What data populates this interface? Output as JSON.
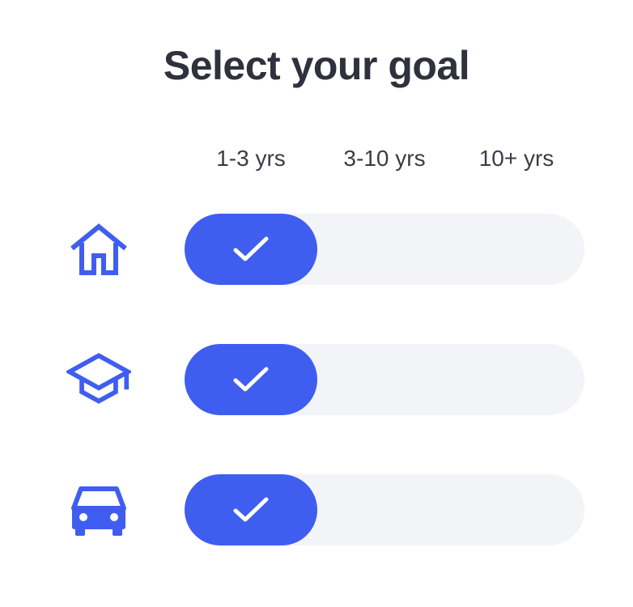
{
  "title": "Select your goal",
  "columns": [
    "1-3 yrs",
    "3-10 yrs",
    "10+ yrs"
  ],
  "rows": [
    {
      "icon": "house-icon",
      "selected": "1-3 yrs"
    },
    {
      "icon": "graduation-cap-icon",
      "selected": "1-3 yrs"
    },
    {
      "icon": "car-icon",
      "selected": "1-3 yrs"
    }
  ],
  "colors": {
    "accent": "#3f5ef0",
    "track": "#f3f4f8",
    "title": "#2f323c",
    "check": "#ffffff"
  }
}
